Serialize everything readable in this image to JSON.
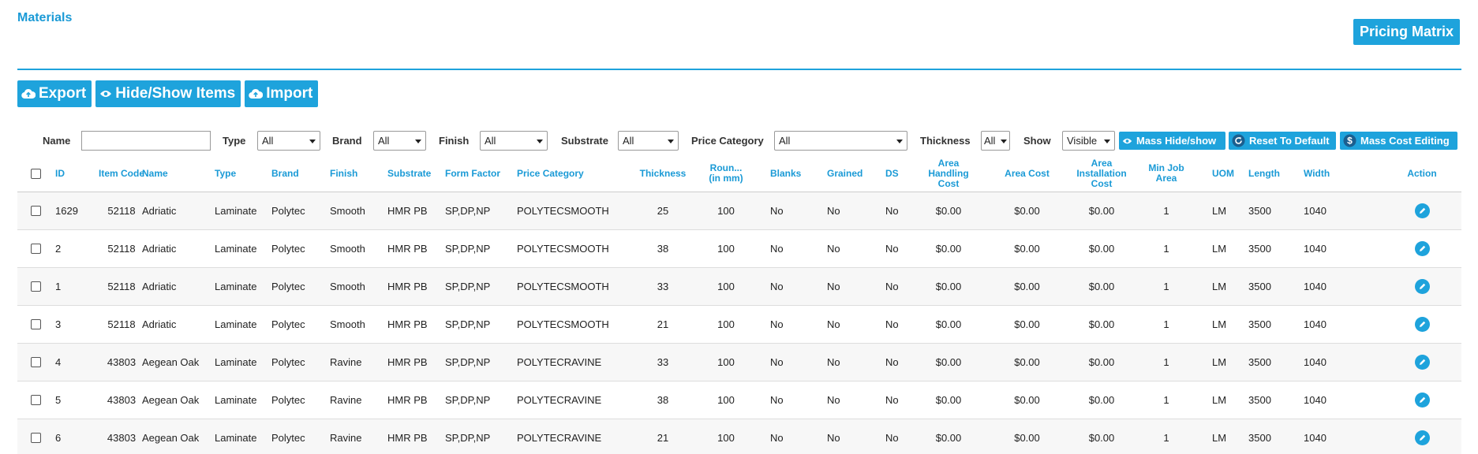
{
  "page": {
    "title": "Materials",
    "pricing_matrix_label": "Pricing Matrix"
  },
  "toolbar": {
    "export_label": "Export",
    "hide_show_label": "Hide/Show Items",
    "import_label": "Import"
  },
  "filters": {
    "name_label": "Name",
    "name_value": "",
    "type_label": "Type",
    "type_value": "All",
    "brand_label": "Brand",
    "brand_value": "All",
    "finish_label": "Finish",
    "finish_value": "All",
    "substrate_label": "Substrate",
    "substrate_value": "All",
    "price_category_label": "Price Category",
    "price_category_value": "All",
    "thickness_label": "Thickness",
    "thickness_value": "All",
    "show_label": "Show",
    "show_value": "Visible",
    "mass_hide_label": "Mass Hide/show",
    "reset_label": "Reset To Default",
    "mass_cost_label": "Mass Cost Editing"
  },
  "columns": {
    "id": "ID",
    "item_code": "Item Code",
    "name": "Name",
    "type": "Type",
    "brand": "Brand",
    "finish": "Finish",
    "substrate": "Substrate",
    "form_factor": "Form Factor",
    "price_category": "Price Category",
    "thickness": "Thickness",
    "rounding": "Roun... (in mm)",
    "blanks": "Blanks",
    "grained": "Grained",
    "ds": "DS",
    "area_handling_cost": "Area Handling Cost",
    "area_cost": "Area Cost",
    "area_installation_cost": "Area Installation Cost",
    "min_job_area": "Min Job Area",
    "uom": "UOM",
    "length": "Length",
    "width": "Width",
    "action": "Action"
  },
  "rows": [
    [
      "1629",
      "52118",
      "Adriatic",
      "Laminate",
      "Polytec",
      "Smooth",
      "HMR PB",
      "SP,DP,NP",
      "POLYTECSMOOTH",
      "25",
      "100",
      "No",
      "No",
      "No",
      "$0.00",
      "$0.00",
      "$0.00",
      "1",
      "LM",
      "3500",
      "1040"
    ],
    [
      "2",
      "52118",
      "Adriatic",
      "Laminate",
      "Polytec",
      "Smooth",
      "HMR PB",
      "SP,DP,NP",
      "POLYTECSMOOTH",
      "38",
      "100",
      "No",
      "No",
      "No",
      "$0.00",
      "$0.00",
      "$0.00",
      "1",
      "LM",
      "3500",
      "1040"
    ],
    [
      "1",
      "52118",
      "Adriatic",
      "Laminate",
      "Polytec",
      "Smooth",
      "HMR PB",
      "SP,DP,NP",
      "POLYTECSMOOTH",
      "33",
      "100",
      "No",
      "No",
      "No",
      "$0.00",
      "$0.00",
      "$0.00",
      "1",
      "LM",
      "3500",
      "1040"
    ],
    [
      "3",
      "52118",
      "Adriatic",
      "Laminate",
      "Polytec",
      "Smooth",
      "HMR PB",
      "SP,DP,NP",
      "POLYTECSMOOTH",
      "21",
      "100",
      "No",
      "No",
      "No",
      "$0.00",
      "$0.00",
      "$0.00",
      "1",
      "LM",
      "3500",
      "1040"
    ],
    [
      "4",
      "43803",
      "Aegean Oak",
      "Laminate",
      "Polytec",
      "Ravine",
      "HMR PB",
      "SP,DP,NP",
      "POLYTECRAVINE",
      "33",
      "100",
      "No",
      "No",
      "No",
      "$0.00",
      "$0.00",
      "$0.00",
      "1",
      "LM",
      "3500",
      "1040"
    ],
    [
      "5",
      "43803",
      "Aegean Oak",
      "Laminate",
      "Polytec",
      "Ravine",
      "HMR PB",
      "SP,DP,NP",
      "POLYTECRAVINE",
      "38",
      "100",
      "No",
      "No",
      "No",
      "$0.00",
      "$0.00",
      "$0.00",
      "1",
      "LM",
      "3500",
      "1040"
    ],
    [
      "6",
      "43803",
      "Aegean Oak",
      "Laminate",
      "Polytec",
      "Ravine",
      "HMR PB",
      "SP,DP,NP",
      "POLYTECRAVINE",
      "21",
      "100",
      "No",
      "No",
      "No",
      "$0.00",
      "$0.00",
      "$0.00",
      "1",
      "LM",
      "3500",
      "1040"
    ]
  ],
  "colors": {
    "accent": "#1ea3dc",
    "header_text": "#1a9ad6"
  },
  "icons": {
    "export": "cloud-upload-icon",
    "hide_show": "eye-icon",
    "import": "cloud-upload-icon",
    "edit": "pencil-icon",
    "reset": "refresh-icon",
    "mass_cost": "dollar-icon"
  }
}
